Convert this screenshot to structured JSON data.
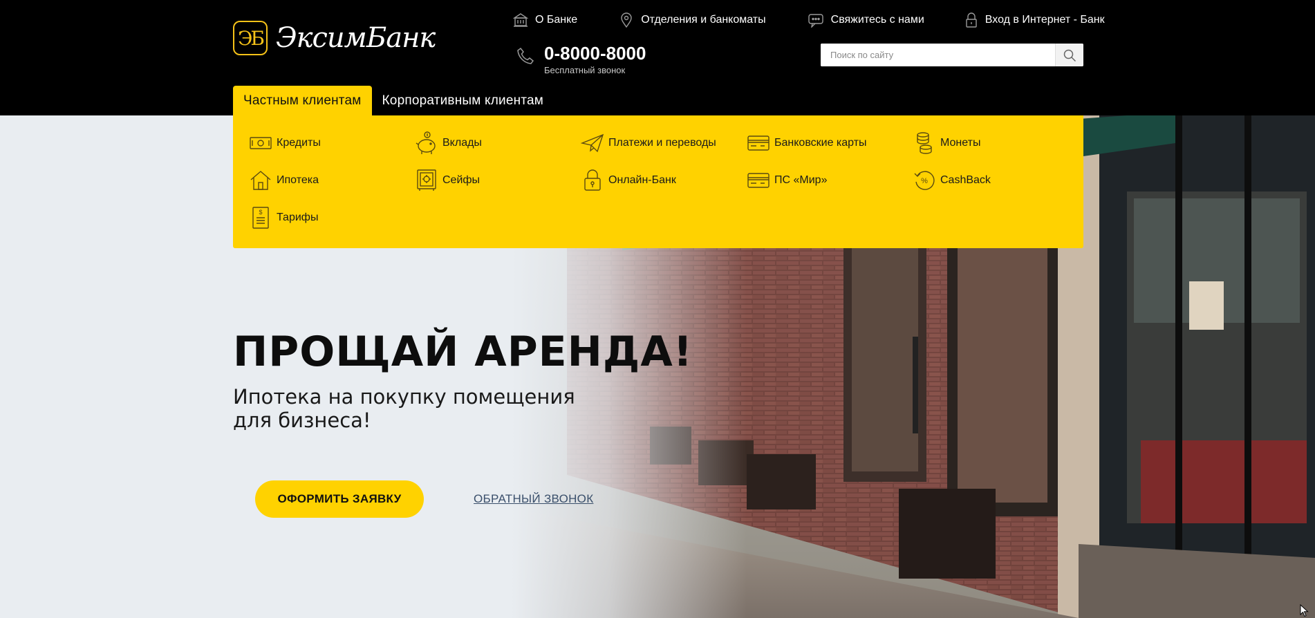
{
  "header": {
    "logo_mark": "ЭБ",
    "logo_text": "ЭксимБанк",
    "top_links": [
      {
        "label": "О Банке",
        "icon": "bank-building-icon"
      },
      {
        "label": "Отделения и банкоматы",
        "icon": "location-pin-icon"
      },
      {
        "label": "Свяжитесь с нами",
        "icon": "chat-bubble-icon"
      },
      {
        "label": "Вход в Интернет - Банк",
        "icon": "padlock-icon"
      }
    ],
    "phone": {
      "number": "0-8000-8000",
      "caption": "Бесплатный звонок",
      "icon": "phone-handset-icon"
    },
    "search": {
      "placeholder": "Поиск по сайту",
      "value": "",
      "icon": "search-icon"
    }
  },
  "tabs": [
    {
      "label": "Частным клиентам",
      "active": true
    },
    {
      "label": "Корпоративным клиентам",
      "active": false
    }
  ],
  "menu": {
    "items": [
      {
        "label": "Кредиты",
        "icon": "banknote-icon"
      },
      {
        "label": "Вклады",
        "icon": "piggy-bank-icon"
      },
      {
        "label": "Платежи и переводы",
        "icon": "paper-plane-icon"
      },
      {
        "label": "Банковские карты",
        "icon": "credit-card-icon"
      },
      {
        "label": "Монеты",
        "icon": "coins-icon"
      },
      {
        "label": "Ипотека",
        "icon": "house-icon"
      },
      {
        "label": "Сейфы",
        "icon": "safe-icon"
      },
      {
        "label": "Онлайн-Банк",
        "icon": "padlock-icon"
      },
      {
        "label": "ПС «Мир»",
        "icon": "credit-card-icon"
      },
      {
        "label": "CashBack",
        "icon": "cashback-percent-icon"
      },
      {
        "label": "Тарифы",
        "icon": "price-list-icon"
      }
    ]
  },
  "hero": {
    "title": "ПРОЩАЙ АРЕНДА!",
    "subtitle": "Ипотека на покупку помещения для бизнеса!",
    "cta_label": "ОФОРМИТЬ ЗАЯВКУ",
    "callback_label": "ОБРАТНЫЙ ЗВОНОК"
  },
  "colors": {
    "accent": "#ffd200",
    "header_bg": "#000000",
    "hero_bg": "#e9edf1",
    "link": "#3a4f6b"
  }
}
